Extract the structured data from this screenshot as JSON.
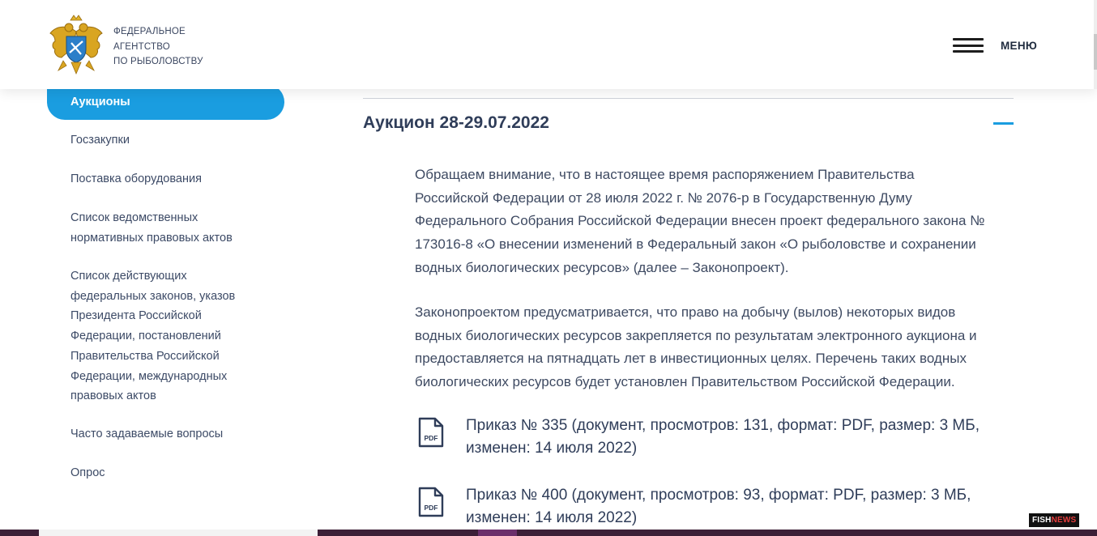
{
  "header": {
    "org_name_lines": [
      "ФЕДЕРАЛЬНОЕ",
      "АГЕНТСТВО",
      "ПО РЫБОЛОВСТВУ"
    ],
    "menu_label": "МЕНЮ",
    "emblem_icon": "coat-of-arms-emblem",
    "menu_icon": "hamburger-icon"
  },
  "sidebar": {
    "active_item": "Аукционы",
    "items": [
      {
        "lines": [
          "Госзакупки"
        ]
      },
      {
        "lines": [
          "Поставка оборудования"
        ]
      },
      {
        "lines": [
          "Список ведомственных",
          "нормативных правовых актов"
        ]
      },
      {
        "lines": [
          "Список действующих",
          "федеральных законов, указов",
          "Президента Российской",
          "Федерации, постановлений",
          "Правительства Российской",
          "Федерации, международных",
          "правовых актов"
        ]
      },
      {
        "lines": [
          "Часто задаваемые вопросы"
        ]
      },
      {
        "lines": [
          "Опрос"
        ]
      }
    ]
  },
  "content": {
    "accordion_title": "Аукцион 28-29.07.2022",
    "paragraph1_lines": [
      "Обращаем внимание, что в настоящее время распоряжением Правительства",
      "Российской Федерации от 28 июля 2022 г. № 2076-р в Государственную Думу",
      "Федерального Собрания Российской Федерации внесен проект федерального закона №",
      "173016-8 «О внесении изменений в Федеральный закон «О рыболовстве и сохранении",
      "водных биологических ресурсов» (далее – Законопроект)."
    ],
    "paragraph2_lines": [
      "Законопроектом предусматривается, что право на добычу (вылов) некоторых видов",
      "водных биологических ресурсов закрепляется по результатам электронного аукциона и",
      "предоставляется на пятнадцать лет в инвестиционных целях. Перечень таких водных",
      "биологических ресурсов будет установлен Правительством Российской Федерации."
    ],
    "documents": [
      {
        "icon_label": "PDF",
        "lines": [
          "Приказ № 335 (документ, просмотров: 131, формат: PDF, размер: 3 МБ,",
          "изменен: 14 июля 2022)"
        ]
      },
      {
        "icon_label": "PDF",
        "lines": [
          "Приказ № 400 (документ, просмотров: 93, формат: PDF, размер: 3 МБ,",
          "изменен: 14 июля 2022)"
        ]
      }
    ]
  },
  "watermark": {
    "part1": "FISH",
    "part2": "NEWS"
  },
  "colors": {
    "accent": "#1a9de0",
    "text": "#3e4a62",
    "heading": "#2f3d59"
  }
}
